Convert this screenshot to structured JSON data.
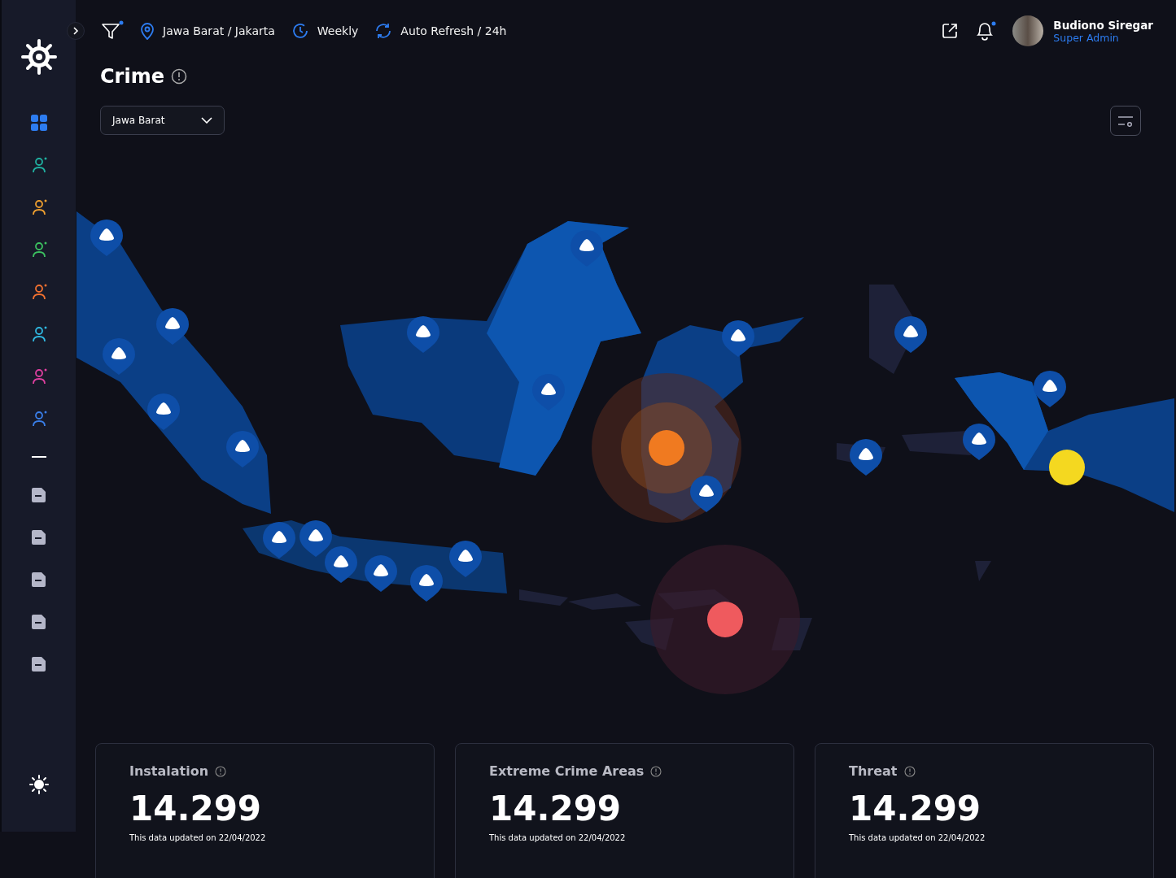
{
  "toolbar": {
    "location": "Jawa Barat / Jakarta",
    "period": "Weekly",
    "refresh": "Auto Refresh / 24h"
  },
  "user": {
    "name": "Budiono Siregar",
    "role": "Super Admin"
  },
  "page": {
    "title": "Crime",
    "region_select": "Jawa Barat"
  },
  "stats": [
    {
      "label": "Instalation",
      "value": "14.299",
      "note": "This data updated on 22/04/2022"
    },
    {
      "label": "Extreme Crime Areas",
      "value": "14.299",
      "note": "This data updated on 22/04/2022"
    },
    {
      "label": "Threat",
      "value": "14.299",
      "note": "This data updated on 22/04/2022"
    }
  ]
}
